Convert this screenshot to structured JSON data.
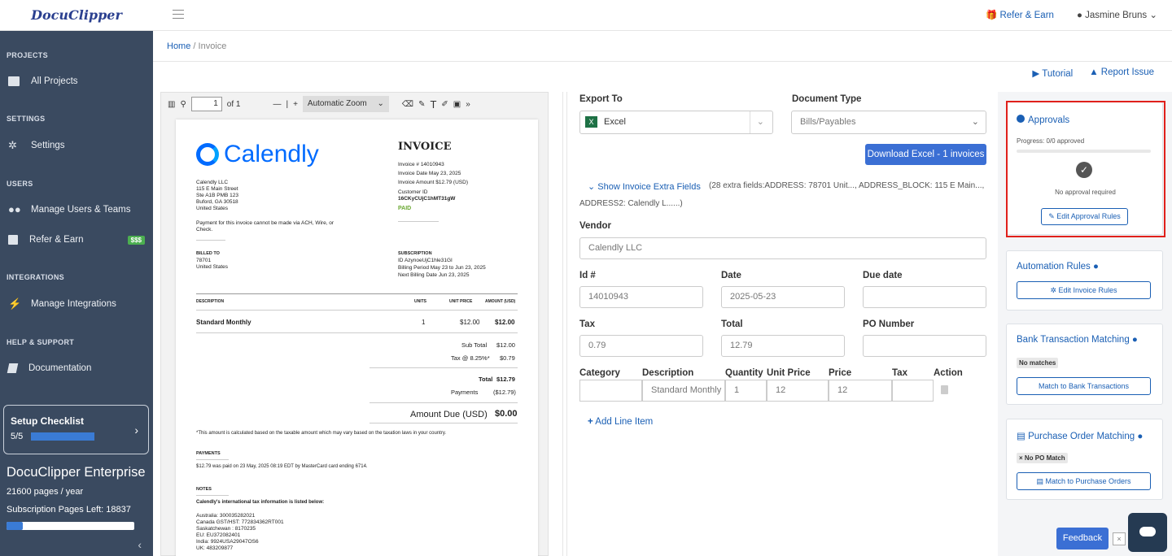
{
  "sidebar": {
    "logo": "DocuClipper",
    "sections": {
      "projects": "PROJECTS",
      "settings": "SETTINGS",
      "users": "USERS",
      "integrations": "INTEGRATIONS",
      "help": "HELP & SUPPORT"
    },
    "items": {
      "all_projects": "All Projects",
      "settings": "Settings",
      "manage_users": "Manage Users & Teams",
      "refer": "Refer & Earn",
      "refer_badge": "$$$",
      "integrations": "Manage Integrations",
      "documentation": "Documentation"
    },
    "checklist": {
      "title": "Setup Checklist",
      "progress": "5/5"
    },
    "plan": {
      "name": "DocuClipper Enterprise",
      "pages": "21600 pages / year",
      "left": "Subscription Pages Left: 18837"
    }
  },
  "topbar": {
    "refer": "Refer & Earn",
    "user": "Jasmine Bruns"
  },
  "breadcrumb": {
    "home": "Home",
    "sep": "/",
    "current": "Invoice"
  },
  "actions": {
    "tutorial": "Tutorial",
    "report": "Report Issue"
  },
  "pdf": {
    "page_input": "1",
    "page_of": "of 1",
    "zoom": "Automatic Zoom",
    "invoice": {
      "title": "INVOICE",
      "invoice_no": "Invoice # 14010943",
      "invoice_date": "Invoice Date May 23, 2025",
      "invoice_amount": "Invoice Amount $12.79 (USD)",
      "customer_id": "Customer ID",
      "customer_val": "16CKyCUjC1hMT31gW",
      "paid": "PAID",
      "from1": "Calendly LLC",
      "from2": "115 E Main Street",
      "from3": "Ste A1B PMB 123",
      "from4": "Buford, GA 30518",
      "from5": "United States",
      "note1": "Payment for this invoice cannot be made via ACH, Wire, or",
      "note2": "Check.",
      "billed_to": "BILLED TO",
      "billed1": "78701",
      "billed2": "United States",
      "sub": "SUBSCRIPTION",
      "sub_id": "ID AzynoeUjC1hle31GI",
      "sub_period": "Billing Period May 23 to Jun 23, 2025",
      "sub_next": "Next Billing Date Jun 23, 2025",
      "col_desc": "DESCRIPTION",
      "col_units": "UNITS",
      "col_price": "UNIT PRICE",
      "col_amount": "AMOUNT (USD)",
      "row_desc": "Standard Monthly",
      "row_units": "1",
      "row_price": "$12.00",
      "row_amount": "$12.00",
      "subtotal_l": "Sub Total",
      "subtotal_v": "$12.00",
      "tax_l": "Tax @ 8.25%*",
      "tax_v": "$0.79",
      "total_l": "Total",
      "total_v": "$12.79",
      "pay_l": "Payments",
      "pay_v": "($12.79)",
      "due_l": "Amount Due (USD)",
      "due_v": "$0.00",
      "footnote": "*This amount is calculated based on the taxable amount which may vary based on the taxation laws in your country.",
      "payments_h": "PAYMENTS",
      "payments_t": "$12.79 was paid on 23 May, 2025 08:19 EDT by MasterCard card ending 6714.",
      "notes_h": "NOTES",
      "notes_t": "Calendly's international tax information is listed below:",
      "tax1": "Australia: 300035282021",
      "tax2": "Canada GST/HST: 772834362RT001",
      "tax3": "Saskatchewan : 8170235",
      "tax4": "EU: EU372082401",
      "tax5": "India: 9924USA29047OS6",
      "tax6": "UK: 483209877"
    }
  },
  "form": {
    "export_label": "Export To",
    "export_value": "Excel",
    "doctype_label": "Document Type",
    "doctype_value": "Bills/Payables",
    "download": "Download Excel - 1 invoices",
    "extra_link": "Show Invoice Extra Fields",
    "extra_text": "(28 extra fields:ADDRESS: 78701 Unit..., ADDRESS_BLOCK: 115 E Main...,",
    "extra_text2": "ADDRESS2: Calendly L......)",
    "vendor_label": "Vendor",
    "vendor_value": "Calendly LLC",
    "id_label": "Id #",
    "id_value": "14010943",
    "date_label": "Date",
    "date_value": "2025-05-23",
    "due_label": "Due date",
    "due_value": "",
    "tax_label": "Tax",
    "tax_value": "0.79",
    "total_label": "Total",
    "total_value": "12.79",
    "po_label": "PO Number",
    "po_value": "",
    "line_headers": {
      "category": "Category",
      "description": "Description",
      "quantity": "Quantity",
      "unit_price": "Unit Price",
      "price": "Price",
      "tax": "Tax",
      "action": "Action"
    },
    "line": {
      "category": "",
      "description": "Standard Monthly",
      "quantity": "1",
      "unit_price": "12",
      "price": "12",
      "tax": ""
    },
    "add_line": "Add Line Item"
  },
  "right": {
    "approvals_title": "Approvals",
    "progress": "Progress: 0/0 approved",
    "no_approval": "No approval required",
    "edit_approval": "Edit Approval Rules",
    "automation_title": "Automation Rules",
    "edit_invoice_rules": "Edit Invoice Rules",
    "bank_title": "Bank Transaction Matching",
    "no_matches": "No matches",
    "match_bank": "Match to Bank Transactions",
    "po_title": "Purchase Order Matching",
    "no_po": "× No PO Match",
    "match_po": "Match to Purchase Orders"
  },
  "feedback": "Feedback",
  "feedback_close": "×"
}
